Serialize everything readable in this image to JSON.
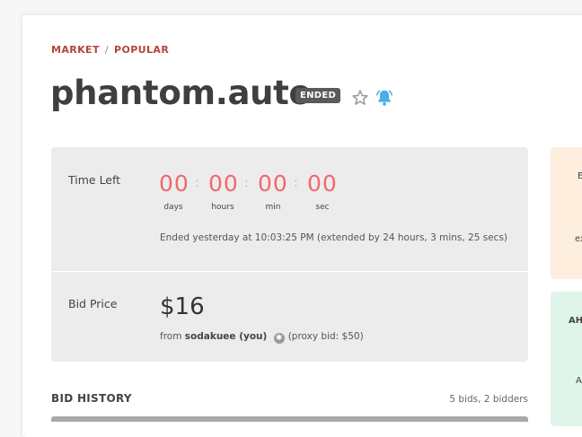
{
  "breadcrumb": {
    "market": "MARKET",
    "separator": "/",
    "popular": "POPULAR"
  },
  "listing": {
    "name": "phantom.auto",
    "status_badge": "ENDED"
  },
  "icons": {
    "watch": "star-icon",
    "notify": "bell-icon",
    "proxy": "asterisk-circle-icon"
  },
  "colors": {
    "accent_red": "#b5433b",
    "countdown": "#f06a6a",
    "bell": "#4aaee6"
  },
  "countdown": {
    "label": "Time Left",
    "days": "00",
    "hours": "00",
    "mins": "00",
    "secs": "00",
    "unit_days": "days",
    "unit_hours": "hours",
    "unit_mins": "min",
    "unit_secs": "sec",
    "separator": ":",
    "ended_note": "Ended yesterday at 10:03:25 PM (extended by 24 hours, 3 mins, 25 secs)"
  },
  "bid": {
    "label": "Bid Price",
    "price": "$16",
    "from_prefix": "from",
    "bidder": "sodakuee (you)",
    "proxy": "(proxy bid: $50)"
  },
  "sidebar": {
    "orange_top": "E",
    "orange_bottom": "ex",
    "green_top": "AH",
    "green_bottom": "A"
  },
  "history": {
    "title": "BID HISTORY",
    "count": "5 bids, 2 bidders"
  }
}
